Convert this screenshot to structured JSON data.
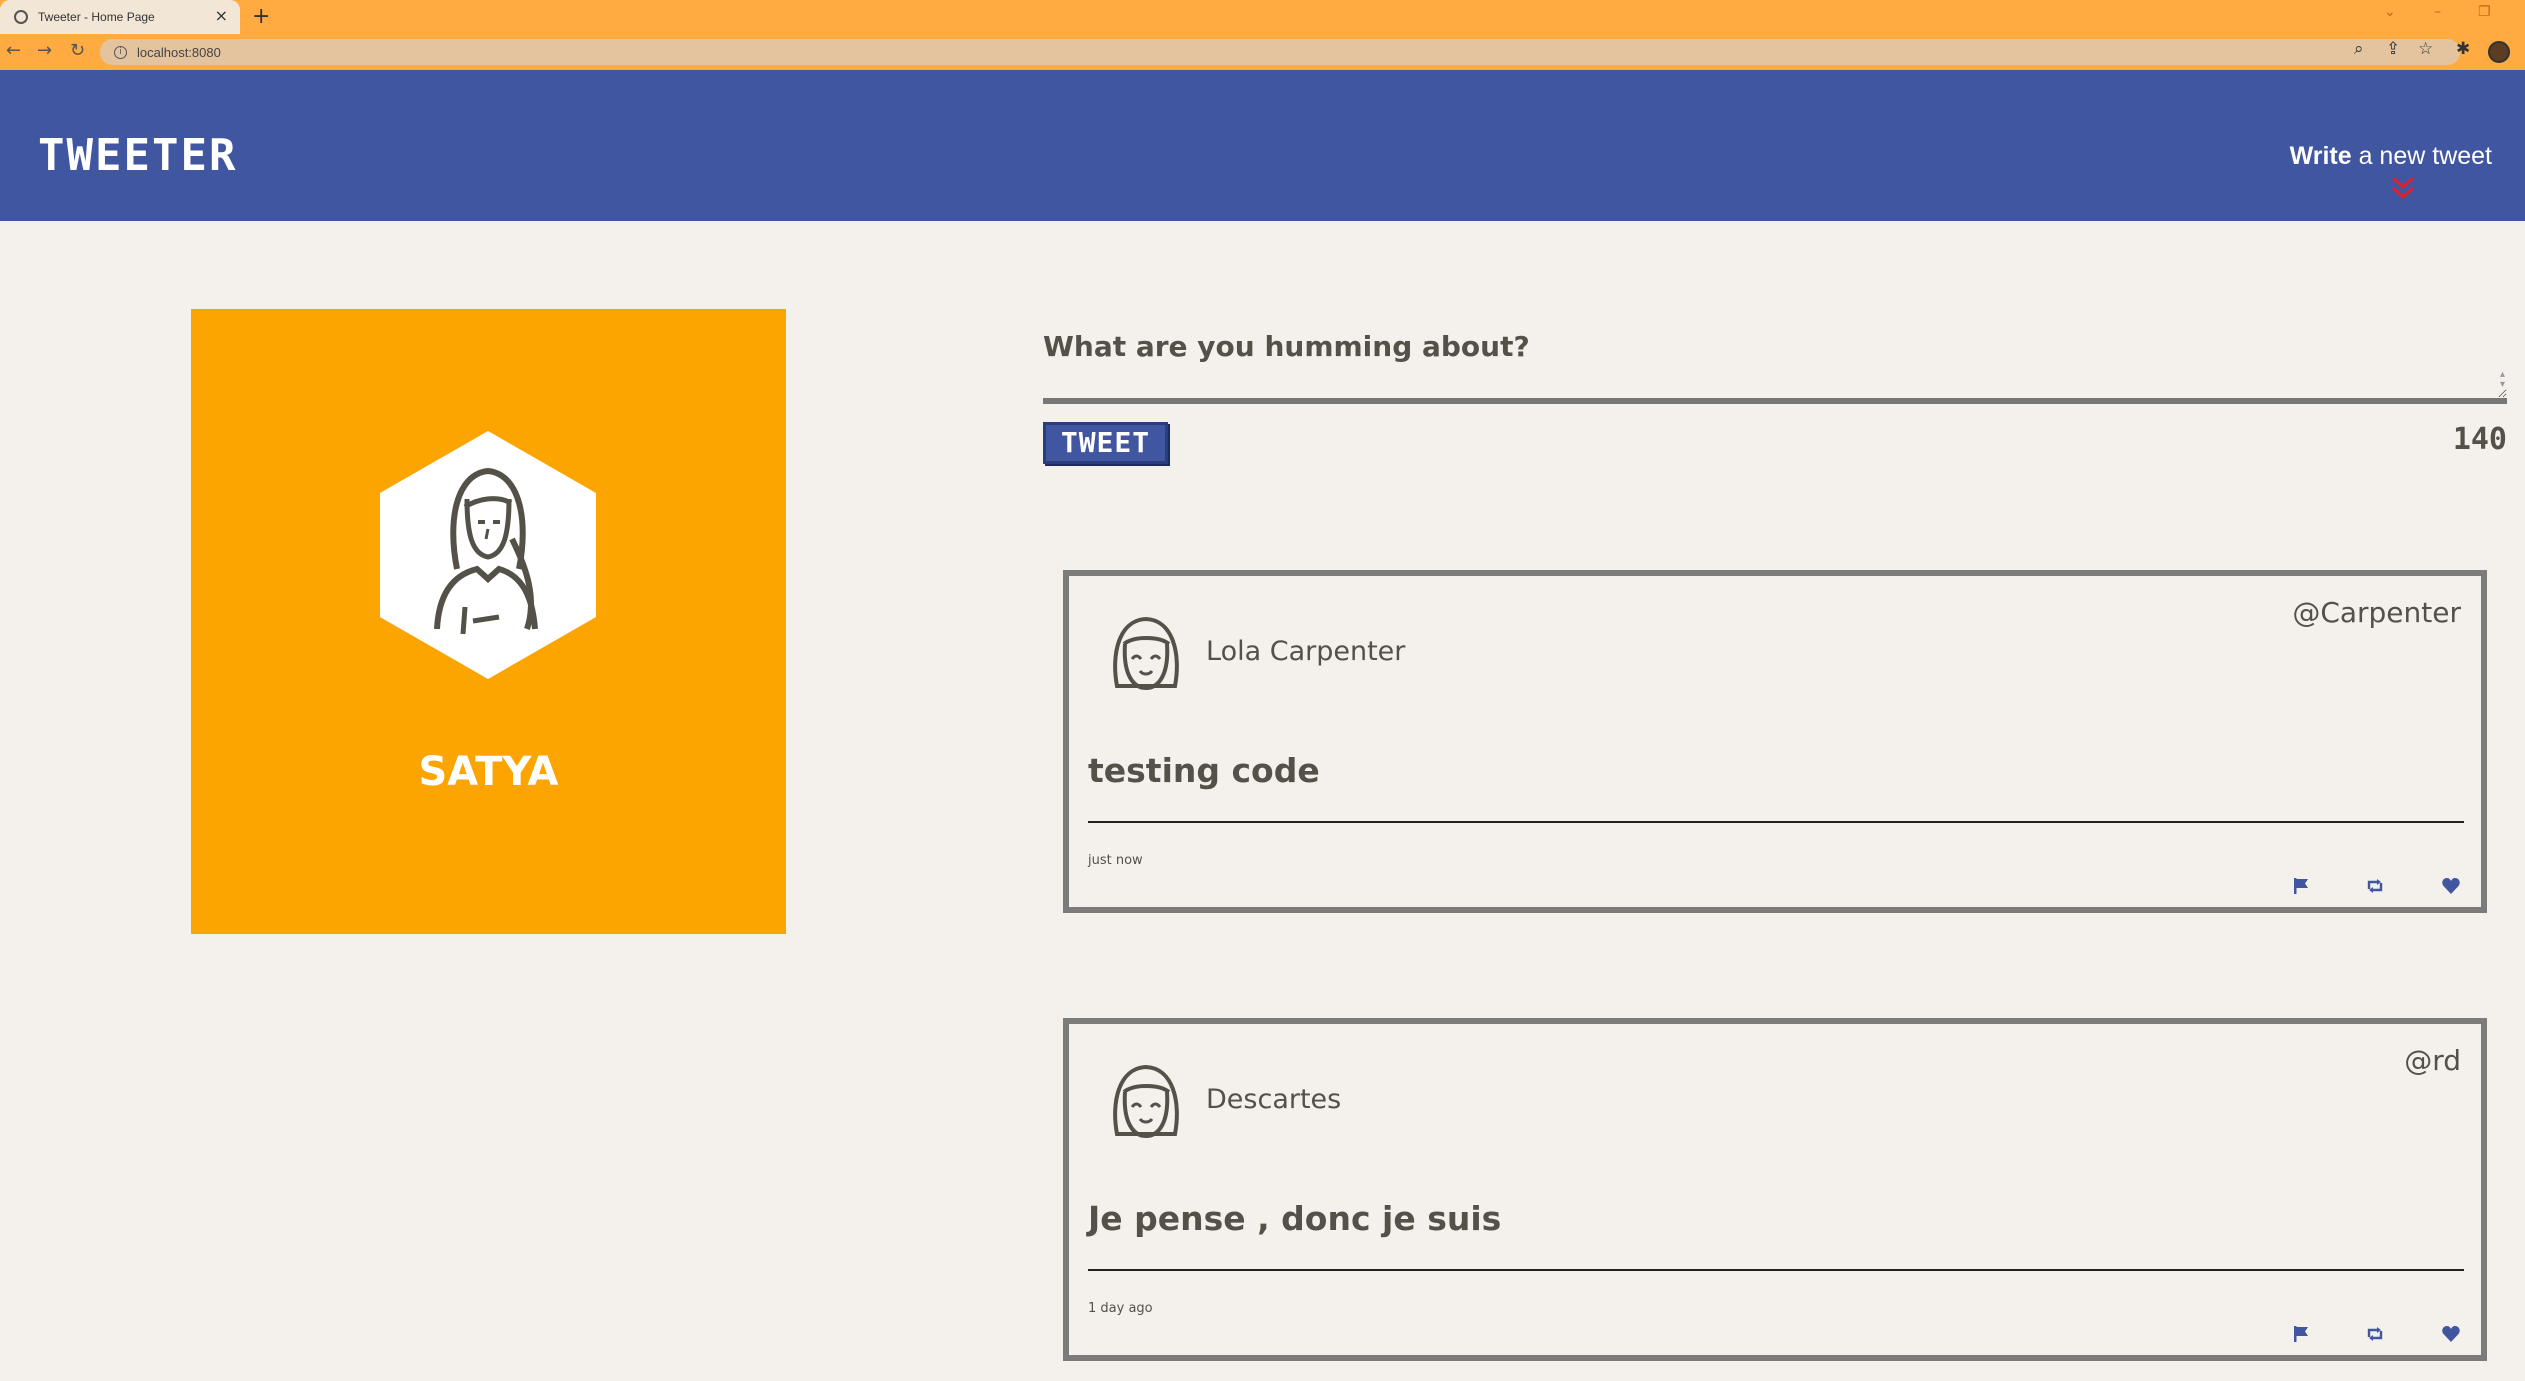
{
  "browser": {
    "tab_title": "Tweeter - Home Page",
    "tab_close": "×",
    "new_tab": "+",
    "url": "localhost:8080",
    "controls": {
      "chevron": "⌄",
      "minimize": "–",
      "restore": "❐"
    },
    "nav": {
      "back": "←",
      "forward": "→",
      "reload": "↻"
    },
    "icons": [
      "zoom-icon",
      "share-icon",
      "star-icon",
      "extensions-icon",
      "profile-avatar"
    ]
  },
  "header": {
    "brand": "TWEETER",
    "compose_strong": "Write",
    "compose_rest": " a new tweet",
    "accent": "#4056a1"
  },
  "profile": {
    "name": "SATYA",
    "card_color": "#fca501"
  },
  "compose": {
    "placeholder": "What are you humming about?",
    "button_label": "TWEET",
    "counter": "140"
  },
  "tweets": [
    {
      "name": "Lola Carpenter",
      "handle": "@Carpenter",
      "text": "testing code",
      "time": "just now"
    },
    {
      "name": "Descartes",
      "handle": "@rd",
      "text": "Je pense , donc je suis",
      "time": "1 day ago"
    }
  ],
  "actions": [
    "flag-icon",
    "retweet-icon",
    "heart-icon"
  ]
}
